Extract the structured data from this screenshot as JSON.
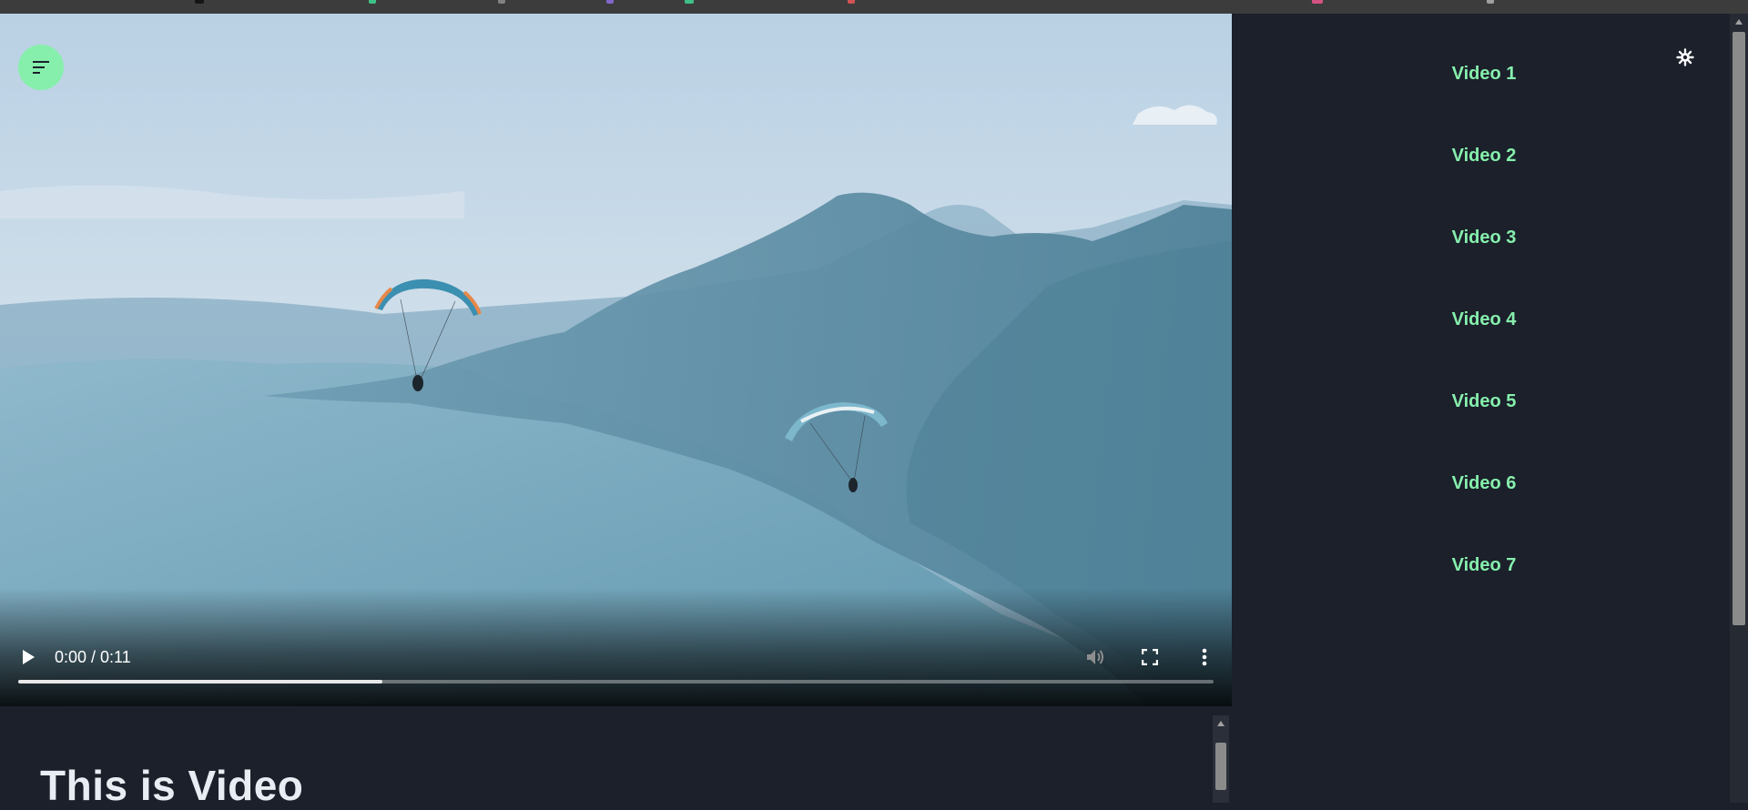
{
  "player": {
    "time_display": "0:00 / 0:11",
    "progress_fraction": 0.305
  },
  "content": {
    "title": "This is Video"
  },
  "sidebar": {
    "settings_icon": "gear-icon",
    "videos": [
      {
        "label": "Video 1"
      },
      {
        "label": "Video 2"
      },
      {
        "label": "Video 3"
      },
      {
        "label": "Video 4"
      },
      {
        "label": "Video 5"
      },
      {
        "label": "Video 6"
      },
      {
        "label": "Video 7"
      }
    ]
  },
  "colors": {
    "accent": "#86efac",
    "background": "#1b202b",
    "title_text": "#e8edf3"
  }
}
